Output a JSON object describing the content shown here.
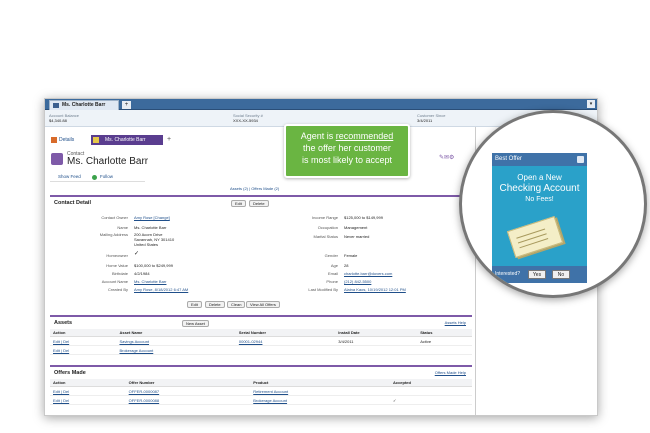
{
  "window": {
    "tab_title": "Ms. Charlotte Barr",
    "add_tab": "+",
    "menu_arrow": "▾"
  },
  "highlights": [
    {
      "label": "Account Balance",
      "value": "$4,340.88"
    },
    {
      "label": "Social Security #",
      "value": "XXX-XX-5934"
    },
    {
      "label": "Customer Since",
      "value": "3/4/2011"
    }
  ],
  "subtabs": {
    "details": "Details",
    "contact": "Ms. Charlotte Barr",
    "add": "+"
  },
  "contact": {
    "type_label": "Contact",
    "name": "Ms. Charlotte Barr"
  },
  "feed": {
    "show_feed": "Show Feed",
    "follow": "Follow"
  },
  "related_links": "Assets (2) | Offers Made (2)",
  "contact_detail": {
    "title": "Contact Detail",
    "edit": "Edit",
    "delete": "Delete",
    "clean": "Clean",
    "view_all_offers": "View All Offers",
    "left": [
      {
        "label": "Contact Owner",
        "value": "Amy Rose [Change]"
      },
      {
        "label": "Name",
        "value": "Ms. Charlotte Barr"
      },
      {
        "label": "Mailing Address",
        "value": "200 Acorn Drive"
      },
      {
        "label": "",
        "value": "Savannah, NY 301410"
      },
      {
        "label": "",
        "value": "United States"
      },
      {
        "label": "Homeowner",
        "value": "✓"
      },
      {
        "label": "Home Value",
        "value": "$100,000 to $249,999"
      },
      {
        "label": "Birthdate",
        "value": "4/2/1984"
      },
      {
        "label": "Account Name",
        "value": "Ms. Charlotte Barr"
      },
      {
        "label": "Created By",
        "value": "Amy Rose, 8/18/2012 6:47 AM"
      }
    ],
    "right": [
      {
        "label": "Income Range",
        "value": "$125,000 to $149,999"
      },
      {
        "label": "Occupation",
        "value": "Management"
      },
      {
        "label": "Marital Status",
        "value": "Never married"
      },
      {
        "label": "Gender",
        "value": "Female"
      },
      {
        "label": "Age",
        "value": "28"
      },
      {
        "label": "Email",
        "value": "charlotte.barr@dovers.com"
      },
      {
        "label": "Phone",
        "value": "(212) 842-5500"
      },
      {
        "label": "Last Modified By",
        "value": "Alaina Kaos, 10/19/2012 12:01 PM"
      }
    ]
  },
  "assets": {
    "title": "Assets",
    "new_button": "New Asset",
    "help": "Assets Help",
    "columns": [
      "Action",
      "Asset Name",
      "Serial Number",
      "Install Date",
      "Status"
    ],
    "rows": [
      [
        "Edit | Del",
        "Savings Account",
        "00001-02944",
        "3/4/2011",
        "Active"
      ],
      [
        "Edit | Del",
        "Brokerage Account",
        "",
        "",
        ""
      ]
    ]
  },
  "offers": {
    "title": "Offers Made",
    "help": "Offers Made Help",
    "columns": [
      "Action",
      "Offer Number",
      "Product",
      "Accepted"
    ],
    "rows": [
      [
        "Edit | Del",
        "OFFER-0000087",
        "Retirement Account",
        ""
      ],
      [
        "Edit | Del",
        "OFFER-0000088",
        "Brokerage Account",
        "✓"
      ]
    ]
  },
  "callout": {
    "line1": "Agent is",
    "line1b": "recommended",
    "line2": "the offer her customer",
    "line3": "is most likely to accept"
  },
  "best_offer": {
    "title": "Best Offer",
    "line1": "Open a New",
    "line2": "Checking Account",
    "line3": "No Fees!",
    "question": "Interested?",
    "yes": "Yes",
    "no": "No"
  },
  "colors": {
    "accent": "#7e5aa8",
    "callout": "#6ab542",
    "offer_bg": "#2aa1c9",
    "header": "#3f72a8"
  }
}
